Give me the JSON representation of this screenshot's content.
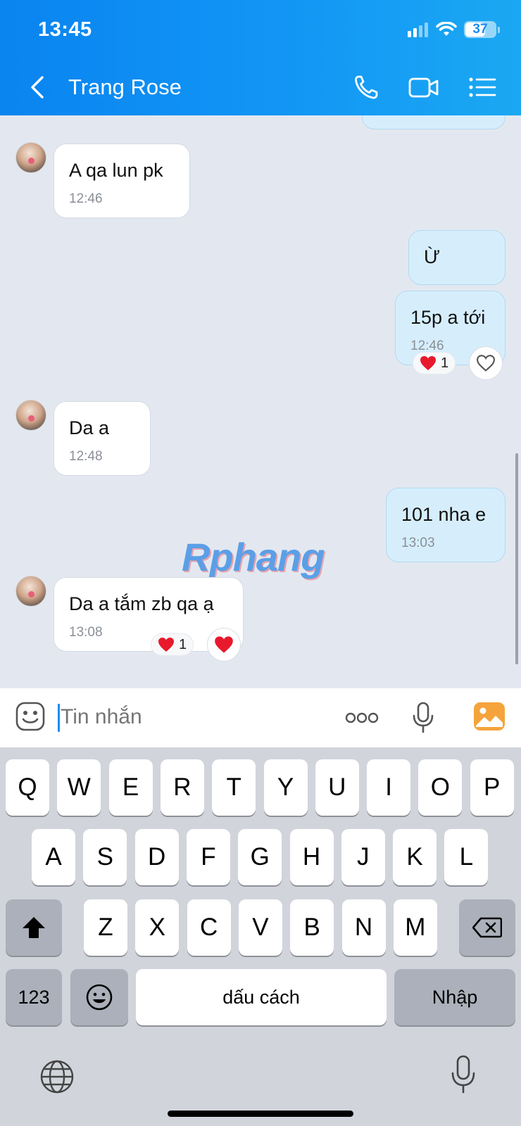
{
  "status": {
    "time": "13:45",
    "battery": "37"
  },
  "header": {
    "title": "Trang Rose"
  },
  "messages": [
    {
      "text": "A qa lun pk",
      "time": "12:46"
    },
    {
      "text": "Ừ"
    },
    {
      "text": "15p a tới",
      "time": "12:46",
      "reaction_count": "1"
    },
    {
      "text": "Da a",
      "time": "12:48"
    },
    {
      "text": "101 nha e",
      "time": "13:03"
    },
    {
      "text": "Da a tắm zb qa ạ",
      "time": "13:08",
      "reaction_count": "1"
    }
  ],
  "watermark": "Rphang",
  "input": {
    "placeholder": "Tin nhắn"
  },
  "keyboard": {
    "row1": [
      "Q",
      "W",
      "E",
      "R",
      "T",
      "Y",
      "U",
      "I",
      "O",
      "P"
    ],
    "row2": [
      "A",
      "S",
      "D",
      "F",
      "G",
      "H",
      "J",
      "K",
      "L"
    ],
    "row3": [
      "Z",
      "X",
      "C",
      "V",
      "B",
      "N",
      "M"
    ],
    "numbers": "123",
    "space": "dấu cách",
    "return": "Nhập"
  },
  "colors": {
    "header_start": "#0a84f0",
    "header_end": "#1ba8f2",
    "outgoing_bubble": "#d6eefc",
    "heart": "#e8192c"
  }
}
